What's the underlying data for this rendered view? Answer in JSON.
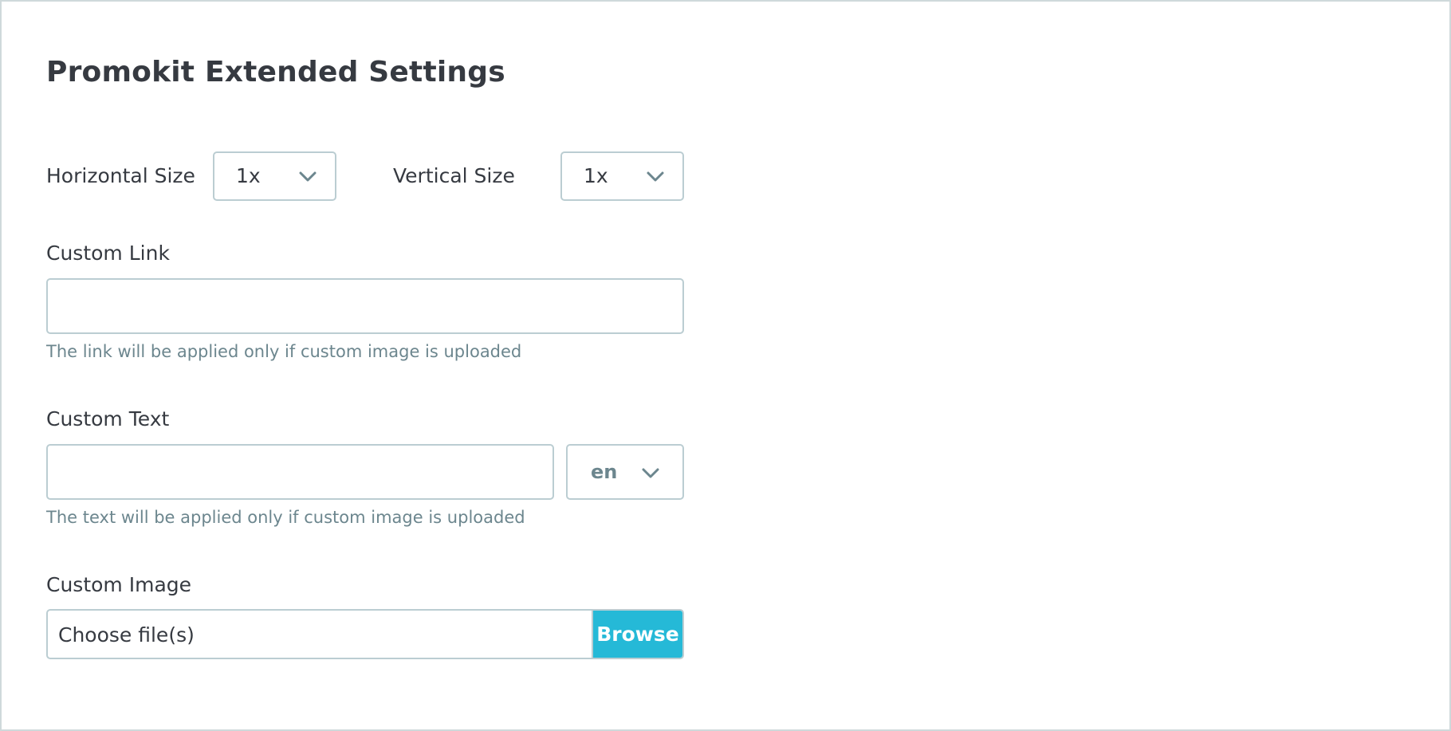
{
  "title": "Promokit Extended Settings",
  "horizontal_size": {
    "label": "Horizontal Size",
    "value": "1x",
    "icon": "chevron-down-icon"
  },
  "vertical_size": {
    "label": "Vertical Size",
    "value": "1x",
    "icon": "chevron-down-icon"
  },
  "custom_link": {
    "label": "Custom Link",
    "value": "",
    "help": "The link will be applied only if custom image is uploaded"
  },
  "custom_text": {
    "label": "Custom Text",
    "value": "",
    "language": "en",
    "help": "The text will be applied only if custom image is uploaded"
  },
  "custom_image": {
    "label": "Custom Image",
    "placeholder": "Choose file(s)",
    "browse_label": "Browse"
  },
  "colors": {
    "border": "#bbcdd2",
    "text": "#363a41",
    "help_text": "#6c868e",
    "accent": "#25b9d7"
  }
}
